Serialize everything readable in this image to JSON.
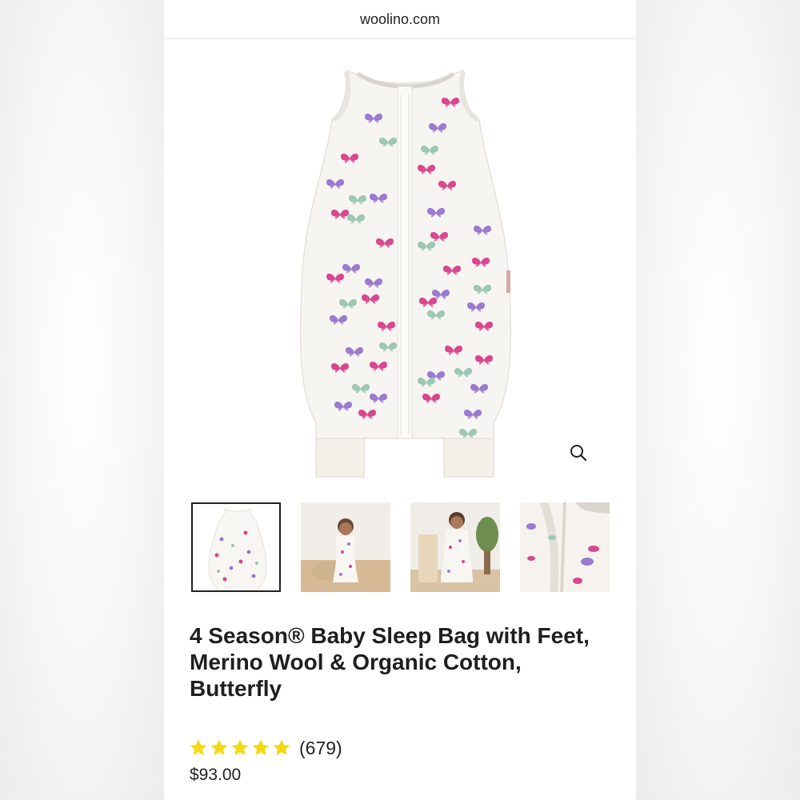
{
  "browser": {
    "url": "woolino.com"
  },
  "product": {
    "title": "4 Season® Baby Sleep Bag with Feet, Merino Wool & Organic Cotton, Butterfly",
    "rating_value": 5,
    "rating_count": "(679)",
    "price": "$93.00",
    "gallery": {
      "selected_index": 0,
      "thumbnails": [
        "product-front",
        "child-sitting",
        "child-standing",
        "fabric-closeup"
      ]
    }
  },
  "colors": {
    "star": "#f4d812",
    "butterfly_purple": "#9b7bd0",
    "butterfly_pink": "#d9478e",
    "butterfly_mint": "#9cc7b4",
    "garment": "#f7f5f1"
  },
  "icons": {
    "zoom": "magnifier-icon",
    "star": "star-icon"
  }
}
